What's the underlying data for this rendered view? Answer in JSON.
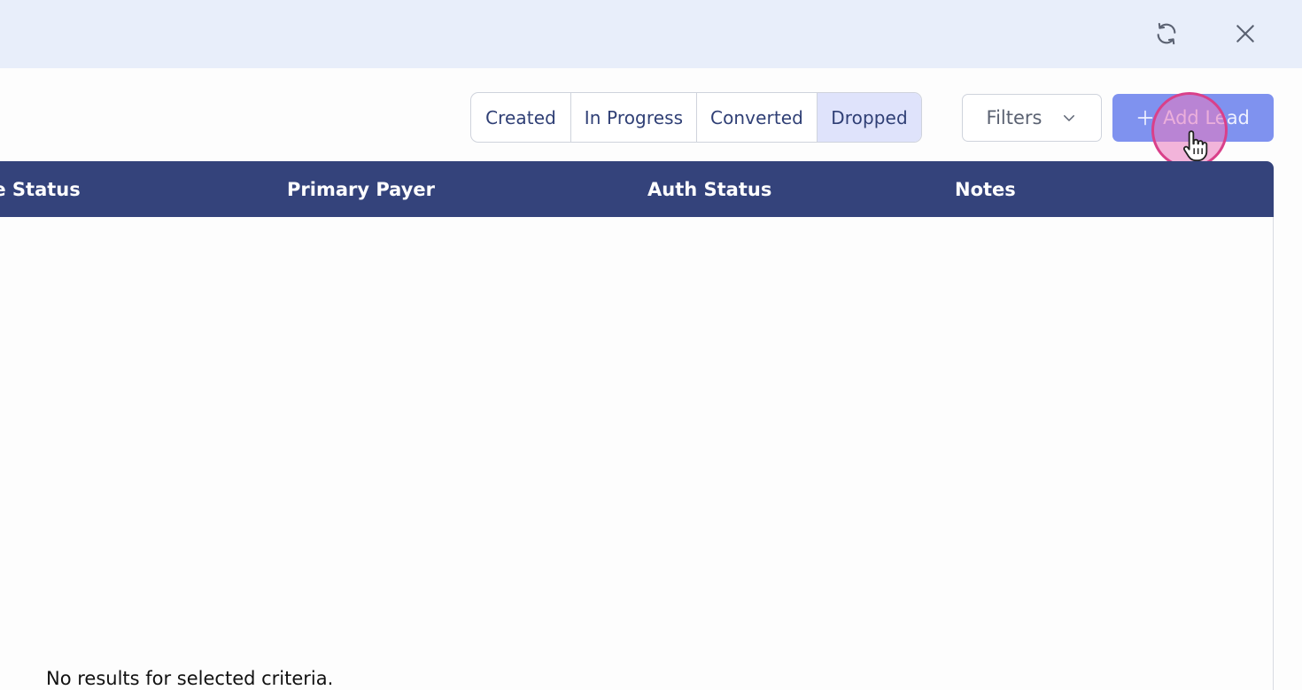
{
  "topbar": {
    "refresh_icon": "refresh-icon",
    "close_icon": "close-icon"
  },
  "status_tabs": [
    {
      "label": "Created"
    },
    {
      "label": "In Progress"
    },
    {
      "label": "Converted"
    },
    {
      "label": "Dropped",
      "selected": true
    }
  ],
  "toolbar": {
    "filters_label": "Filters",
    "add_lead_label": "Add Lead"
  },
  "table": {
    "columns": [
      "Stage Status",
      "Primary Payer",
      "Auth Status",
      "Notes"
    ],
    "empty_message": "No results for selected criteria."
  },
  "colors": {
    "header_bg": "#34437b",
    "accent": "#7f92ef",
    "selected_tab": "#dfe3fb",
    "topbar_bg": "#e8eefa"
  }
}
